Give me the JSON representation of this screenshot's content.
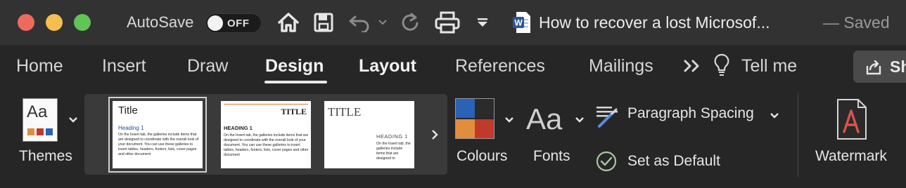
{
  "titlebar": {
    "autosave_label": "AutoSave",
    "autosave_state": "OFF",
    "document_title": "How to recover a lost Microsof...",
    "saved_status": "— Saved",
    "icons": [
      "home-icon",
      "save-icon",
      "undo-icon",
      "redo-icon",
      "print-icon",
      "customize-toolbar-icon",
      "word-document-icon"
    ]
  },
  "tabs": [
    {
      "label": "Home"
    },
    {
      "label": "Insert"
    },
    {
      "label": "Draw"
    },
    {
      "label": "Design",
      "active": true
    },
    {
      "label": "Layout"
    },
    {
      "label": "References"
    },
    {
      "label": "Mailings"
    },
    {
      "label": "Tell me"
    }
  ],
  "share": {
    "label": "Sh"
  },
  "ribbon": {
    "themes": {
      "label": "Themes",
      "icon_text": "Aa"
    },
    "gallery": [
      {
        "title": "Title",
        "heading": "Heading 1",
        "body": "On the Insert tab, the galleries include items that are designed to coordinate with the overall look of your document. You can use these galleries to insert tables, headers, footers, lists, cover pages and other document"
      },
      {
        "title": "TITLE",
        "heading": "HEADING 1",
        "body": "On the Insert tab, the galleries include items that are designed to coordinate with the overall look of your document. You can use these galleries to insert tables, headers, footers, lists, cover pages and other document"
      },
      {
        "title": "TITLE",
        "heading": "HEADING 1",
        "body": "On the Insert tab, the galleries include items that are designed to"
      }
    ],
    "colours": {
      "label": "Colours",
      "swatches": [
        "#2a62b8",
        "#2b2b2b",
        "#e08e3e",
        "#c0392b"
      ]
    },
    "fonts": {
      "label": "Fonts",
      "icon_text": "Aa"
    },
    "paragraph_spacing": {
      "label": "Paragraph Spacing"
    },
    "set_as_default": {
      "label": "Set as Default"
    },
    "watermark": {
      "label": "Watermark"
    }
  },
  "colors": {
    "accent_orange": "#d27d3a",
    "word_blue": "#2b579a"
  }
}
